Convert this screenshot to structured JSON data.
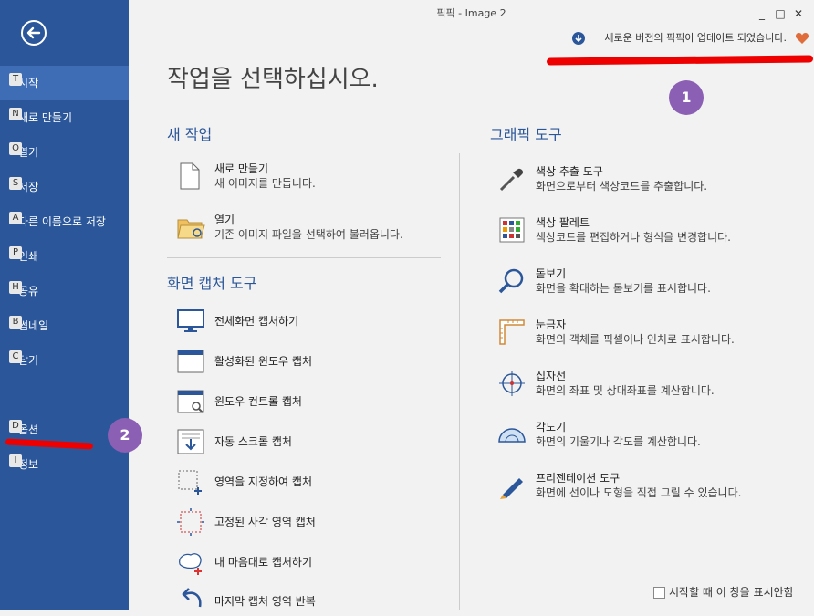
{
  "window": {
    "title": "픽픽 - Image 2",
    "controls": [
      "_",
      "□",
      "✕"
    ]
  },
  "sidebar": {
    "items": [
      {
        "key": "T",
        "label": "시작",
        "active": true
      },
      {
        "key": "N",
        "label": "새로 만들기"
      },
      {
        "key": "O",
        "label": "열기"
      },
      {
        "key": "S",
        "label": "저장"
      },
      {
        "key": "A",
        "label": "다른 이름으로 저장"
      },
      {
        "key": "P",
        "label": "인쇄"
      },
      {
        "key": "H",
        "label": "공유"
      },
      {
        "key": "B",
        "label": "썸네일"
      },
      {
        "key": "C",
        "label": "닫기"
      },
      {
        "key": "D",
        "label": "옵션"
      },
      {
        "key": "I",
        "label": "정보"
      }
    ]
  },
  "update_notice": "새로운 버전의 픽픽이 업데이트 되었습니다.",
  "page_title": "작업을 선택하십시오.",
  "sections": {
    "new_task": {
      "title": "새 작업",
      "items": [
        {
          "name": "새로 만들기",
          "desc": "새 이미지를 만듭니다.",
          "icon": "blank-page-icon"
        },
        {
          "name": "열기",
          "desc": "기존 이미지 파일을 선택하여 불러옵니다.",
          "icon": "open-folder-icon"
        }
      ]
    },
    "capture": {
      "title": "화면 캡처 도구",
      "items": [
        {
          "name": "전체화면 캡처하기",
          "icon": "monitor-icon"
        },
        {
          "name": "활성화된 윈도우 캡처",
          "icon": "window-icon"
        },
        {
          "name": "윈도우 컨트롤 캡처",
          "icon": "window-control-icon"
        },
        {
          "name": "자동 스크롤 캡처",
          "icon": "scroll-capture-icon"
        },
        {
          "name": "영역을 지정하여 캡처",
          "icon": "region-icon"
        },
        {
          "name": "고정된 사각 영역 캡처",
          "icon": "fixed-region-icon"
        },
        {
          "name": "내 마음대로 캡처하기",
          "icon": "freehand-icon"
        },
        {
          "name": "마지막 캡처 영역 반복",
          "icon": "repeat-icon"
        }
      ]
    },
    "graphic": {
      "title": "그래픽 도구",
      "items": [
        {
          "name": "색상 추출 도구",
          "desc": "화면으로부터 색상코드를 추출합니다.",
          "icon": "eyedropper-icon"
        },
        {
          "name": "색상 팔레트",
          "desc": "색상코드를 편집하거나 형식을 변경합니다.",
          "icon": "palette-icon"
        },
        {
          "name": "돋보기",
          "desc": "화면을 확대하는 돋보기를 표시합니다.",
          "icon": "magnifier-icon"
        },
        {
          "name": "눈금자",
          "desc": "화면의 객체를 픽셀이나 인치로 표시합니다.",
          "icon": "ruler-icon"
        },
        {
          "name": "십자선",
          "desc": "화면의 좌표 및 상대좌표를 계산합니다.",
          "icon": "crosshair-icon"
        },
        {
          "name": "각도기",
          "desc": "화면의 기울기나 각도를 계산합니다.",
          "icon": "protractor-icon"
        },
        {
          "name": "프리젠테이션 도구",
          "desc": "화면에 선이나 도형을 직접 그릴 수 있습니다.",
          "icon": "pen-icon"
        }
      ]
    }
  },
  "checkbox_label": "시작할 때 이 창을 표시안함",
  "annotations": {
    "badge1": "1",
    "badge2": "2"
  }
}
